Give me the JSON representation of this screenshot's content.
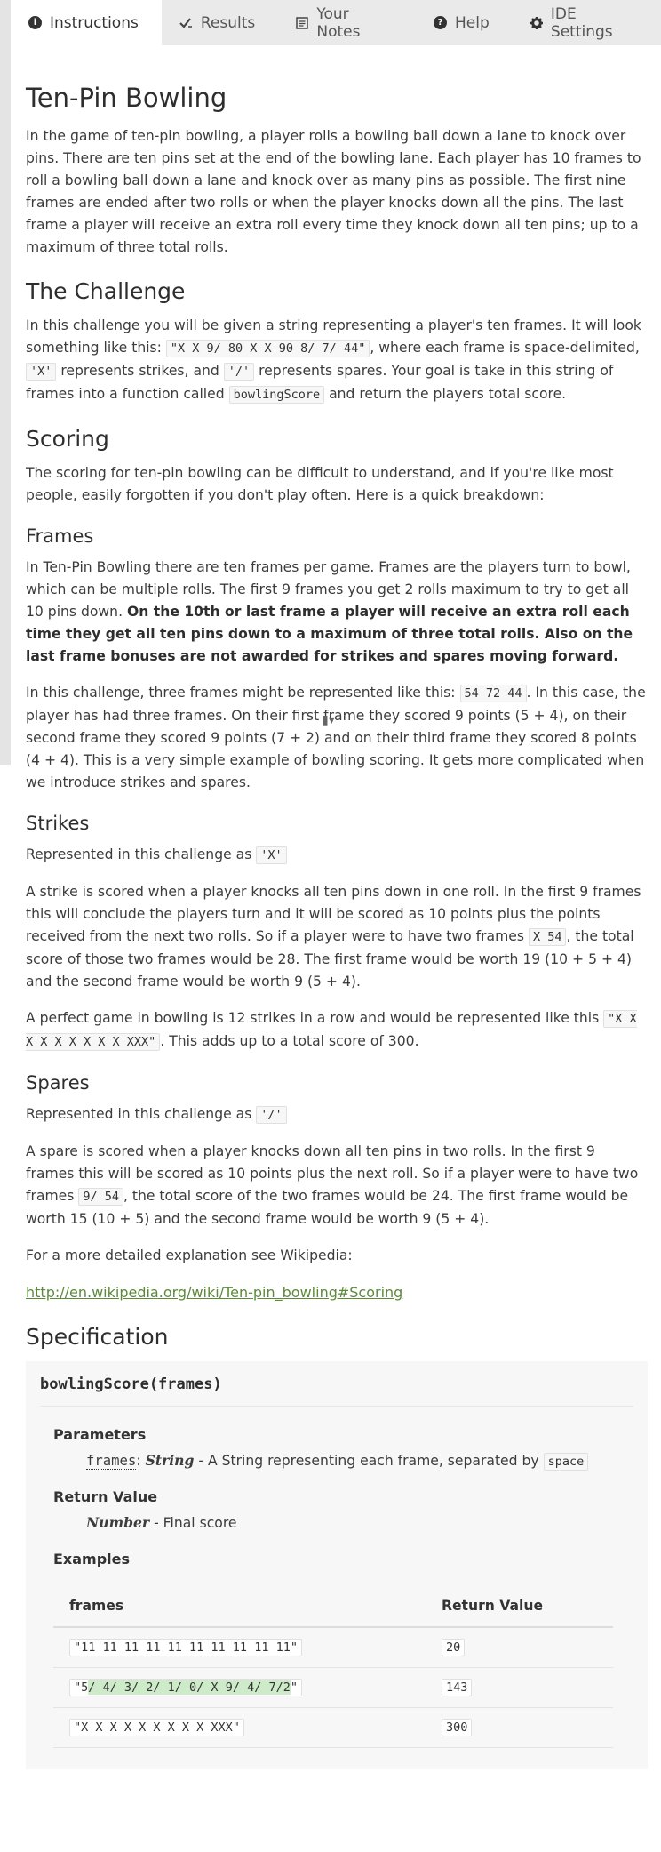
{
  "tabs": [
    {
      "label": "Instructions",
      "icon": "info-icon"
    },
    {
      "label": "Results",
      "icon": "check-icon"
    },
    {
      "label": "Your Notes",
      "icon": "notes-icon"
    },
    {
      "label": "Help",
      "icon": "question-icon"
    },
    {
      "label": "IDE Settings",
      "icon": "gear-icon"
    }
  ],
  "title": "Ten-Pin Bowling",
  "intro": "In the game of ten-pin bowling, a player rolls a bowling ball down a lane to knock over pins. There are ten pins set at the end of the bowling lane. Each player has 10 frames to roll a bowling ball down a lane and knock over as many pins as possible. The first nine frames are ended after two rolls or when the player knocks down all the pins. The last frame a player will receive an extra roll every time they knock down all ten pins; up to a maximum of three total rolls.",
  "challenge": {
    "heading": "The Challenge",
    "t1": "In this challenge you will be given a string representing a player's ten frames. It will look something like this: ",
    "c1": "\"X X 9/ 80 X X 90 8/ 7/ 44\"",
    "t2": ", where each frame is space-delimited, ",
    "c2": "'X'",
    "t3": " represents strikes, and ",
    "c3": "'/'",
    "t4": " represents spares. Your goal is take in this string of frames into a function called ",
    "c4": "bowlingScore",
    "t5": " and return the players total score."
  },
  "scoring": {
    "heading": "Scoring",
    "text": "The scoring for ten-pin bowling can be difficult to understand, and if you're like most people, easily forgotten if you don't play often. Here is a quick breakdown:"
  },
  "frames": {
    "heading": "Frames",
    "t1": "In Ten-Pin Bowling there are ten frames per game. Frames are the players turn to bowl, which can be multiple rolls. The first 9 frames you get 2 rolls maximum to try to get all 10 pins down. ",
    "bold": "On the 10th or last frame a player will receive an extra roll each time they get all ten pins down to a maximum of three total rolls. Also on the last frame bonuses are not awarded for strikes and spares moving forward.",
    "p2a": "In this challenge, three frames might be represented like this: ",
    "p2code": "54 72 44",
    "p2b": ". In this case, the player has had three frames. On their first frame they scored 9 points (5 + 4), on their second frame they scored 9 points (7 + 2) and on their third frame they scored 8 points (4 + 4). This is a very simple example of bowling scoring. It gets more complicated when we introduce strikes and spares."
  },
  "strikes": {
    "heading": "Strikes",
    "rep": "Represented in this challenge as ",
    "rep_code": "'X'",
    "p1a": "A strike is scored when a player knocks all ten pins down in one roll. In the first 9 frames this will conclude the players turn and it will be scored as 10 points plus the points received from the next two rolls. So if a player were to have two frames ",
    "p1code": "X 54",
    "p1b": ", the total score of those two frames would be 28. The first frame would be worth 19 (10 + 5 + 4) and the second frame would be worth 9 (5 + 4).",
    "p2a": "A perfect game in bowling is 12 strikes in a row and would be represented like this ",
    "p2code": "\"X X X X X X X X X XXX\"",
    "p2b": ". This adds up to a total score of 300."
  },
  "spares": {
    "heading": "Spares",
    "rep": "Represented in this challenge as ",
    "rep_code": "'/'",
    "p1a": "A spare is scored when a player knocks down all ten pins in two rolls. In the first 9 frames this will be scored as 10 points plus the next roll. So if a player were to have two frames ",
    "p1code": "9/ 54",
    "p1b": ", the total score of the two frames would be 24. The first frame would be worth 15 (10 + 5) and the second frame would be worth 9 (5 + 4).",
    "more": "For a more detailed explanation see Wikipedia:",
    "link": "http://en.wikipedia.org/wiki/Ten-pin_bowling#Scoring"
  },
  "spec": {
    "heading": "Specification",
    "signature": "bowlingScore(frames)",
    "params_label": "Parameters",
    "param_name": "frames",
    "param_type": "String",
    "param_desc": " - A String representing each frame, separated by ",
    "param_code": "space",
    "return_label": "Return Value",
    "return_type": "Number",
    "return_desc": " - Final score",
    "examples_label": "Examples",
    "col_frames": "frames",
    "col_return": "Return Value",
    "rows": [
      {
        "frames": "\"11 11 11 11 11 11 11 11 11 11\"",
        "ret": "20"
      },
      {
        "frames_pre": "\"5",
        "frames_hl": "/ 4/ 3/ 2/ 1/ 0/ X 9/ 4/ 7/2",
        "frames_post": "\"",
        "ret": "143"
      },
      {
        "frames": "\"X X X X X X X X X XXX\"",
        "ret": "300"
      }
    ]
  }
}
